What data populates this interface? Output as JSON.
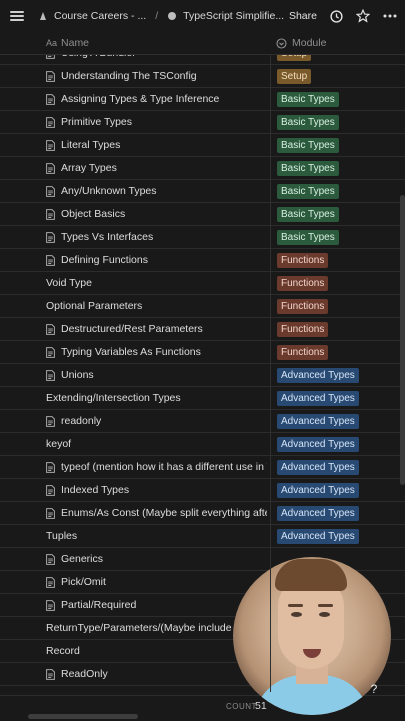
{
  "topbar": {
    "breadcrumb_1": "Course Careers - ...",
    "separator": "/",
    "breadcrumb_2": "TypeScript Simplifie...",
    "share_label": "Share"
  },
  "table": {
    "columns": {
      "name": "Name",
      "module": "Module"
    },
    "rows": [
      {
        "name": "Using A Bundler",
        "doc": true,
        "module": "Setup",
        "kind": "setup"
      },
      {
        "name": "Understanding The TSConfig",
        "doc": true,
        "module": "Setup",
        "kind": "setup"
      },
      {
        "name": "Assigning Types & Type Inference",
        "doc": true,
        "module": "Basic Types",
        "kind": "basic"
      },
      {
        "name": "Primitive Types",
        "doc": true,
        "module": "Basic Types",
        "kind": "basic"
      },
      {
        "name": "Literal Types",
        "doc": true,
        "module": "Basic Types",
        "kind": "basic"
      },
      {
        "name": "Array Types",
        "doc": true,
        "module": "Basic Types",
        "kind": "basic"
      },
      {
        "name": "Any/Unknown Types",
        "doc": true,
        "module": "Basic Types",
        "kind": "basic"
      },
      {
        "name": "Object Basics",
        "doc": true,
        "module": "Basic Types",
        "kind": "basic"
      },
      {
        "name": "Types Vs Interfaces",
        "doc": true,
        "module": "Basic Types",
        "kind": "basic"
      },
      {
        "name": "Defining Functions",
        "doc": true,
        "module": "Functions",
        "kind": "functions"
      },
      {
        "name": "Void Type",
        "doc": false,
        "module": "Functions",
        "kind": "functions"
      },
      {
        "name": "Optional Parameters",
        "doc": false,
        "module": "Functions",
        "kind": "functions"
      },
      {
        "name": "Destructured/Rest Parameters",
        "doc": true,
        "module": "Functions",
        "kind": "functions"
      },
      {
        "name": "Typing Variables As Functions",
        "doc": true,
        "module": "Functions",
        "kind": "functions"
      },
      {
        "name": "Unions",
        "doc": true,
        "module": "Advanced Types",
        "kind": "advanced"
      },
      {
        "name": "Extending/Intersection Types",
        "doc": false,
        "module": "Advanced Types",
        "kind": "advanced"
      },
      {
        "name": "readonly",
        "doc": true,
        "module": "Advanced Types",
        "kind": "advanced"
      },
      {
        "name": "keyof",
        "doc": false,
        "module": "Advanced Types",
        "kind": "advanced"
      },
      {
        "name": "typeof (mention how it has a different use in TS)",
        "doc": true,
        "module": "Advanced Types",
        "kind": "advanced"
      },
      {
        "name": "Indexed Types",
        "doc": true,
        "module": "Advanced Types",
        "kind": "advanced"
      },
      {
        "name": "Enums/As Const (Maybe split everything after",
        "doc": true,
        "module": "Advanced Types",
        "kind": "advanced"
      },
      {
        "name": "Tuples",
        "doc": false,
        "module": "Advanced Types",
        "kind": "advanced"
      },
      {
        "name": "Generics",
        "doc": true,
        "module": "",
        "kind": "advanced"
      },
      {
        "name": "Pick/Omit",
        "doc": true,
        "module": "",
        "kind": "advanced"
      },
      {
        "name": "Partial/Required",
        "doc": true,
        "module": "",
        "kind": "advanced"
      },
      {
        "name": "ReturnType/Parameters/(Maybe include Awaited)",
        "doc": false,
        "module": "",
        "kind": "advanced"
      },
      {
        "name": "Record",
        "doc": false,
        "module": "",
        "kind": "advanced"
      },
      {
        "name": "ReadOnly",
        "doc": true,
        "module": "",
        "kind": "advanced"
      }
    ]
  },
  "footer": {
    "count_label": "COUNT",
    "count_value": "51"
  },
  "help_label": "?",
  "colors": {
    "background": "#191919",
    "setup": "#7a5a2b",
    "basic": "#2b5a3d",
    "functions": "#6a3a2c",
    "advanced": "#284a72"
  },
  "icons": [
    "menu-icon",
    "page-icon",
    "clock-icon",
    "star-icon",
    "more-icon",
    "text-property-icon",
    "select-property-icon",
    "document-icon"
  ]
}
